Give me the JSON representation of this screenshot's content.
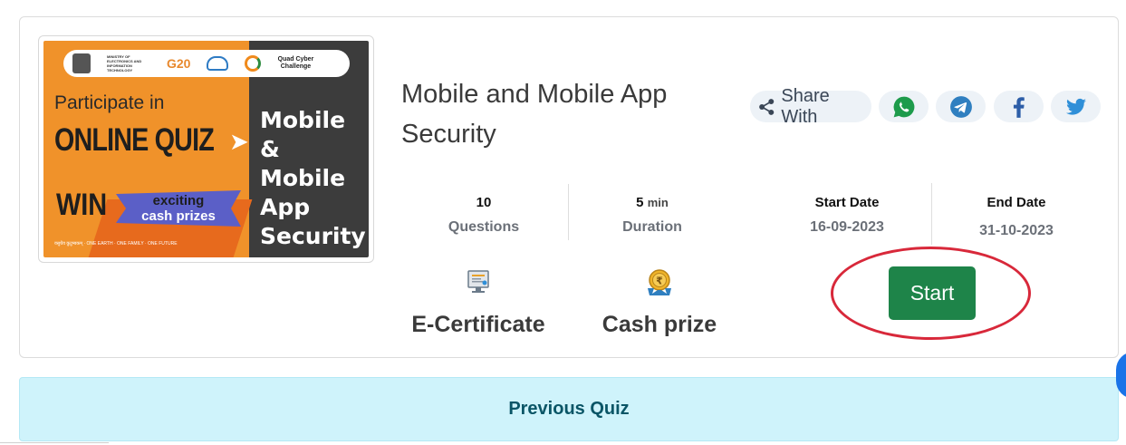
{
  "banner": {
    "logo_ministry_text": "MINISTRY OF ELECTRONICS AND INFORMATION TECHNOLOGY",
    "logo_g20": "G20",
    "logo_quad": "Quad Cyber Challenge",
    "participate": "Participate in",
    "online_quiz": "ONLINE QUIZ",
    "win": "WIN",
    "exciting": "exciting",
    "cash_prizes": "cash prizes",
    "title_line1": "Mobile",
    "title_line2": "& Mobile",
    "title_line3": "App",
    "title_line4": "Security",
    "tagline": "वसुधैव कुटुम्बकम् · ONE EARTH · ONE FAMILY · ONE FUTURE"
  },
  "quiz": {
    "title": "Mobile and Mobile App Security"
  },
  "share": {
    "label": "Share With",
    "buttons": [
      "whatsapp-icon",
      "telegram-icon",
      "facebook-icon",
      "twitter-icon"
    ]
  },
  "stats": {
    "questions_value": "10",
    "questions_label": "Questions",
    "duration_value": "5",
    "duration_unit": "min",
    "duration_label": "Duration",
    "start_label": "Start Date",
    "start_value": "16-09-2023",
    "end_label": "End Date",
    "end_value": "31-10-2023"
  },
  "features": {
    "certificate": "E-Certificate",
    "cash": "Cash prize"
  },
  "actions": {
    "start": "Start",
    "previous_quiz": "Previous Quiz"
  },
  "colors": {
    "start_button": "#1e8449",
    "annotation": "#d8283a",
    "previous_bg": "#cff3fb"
  }
}
